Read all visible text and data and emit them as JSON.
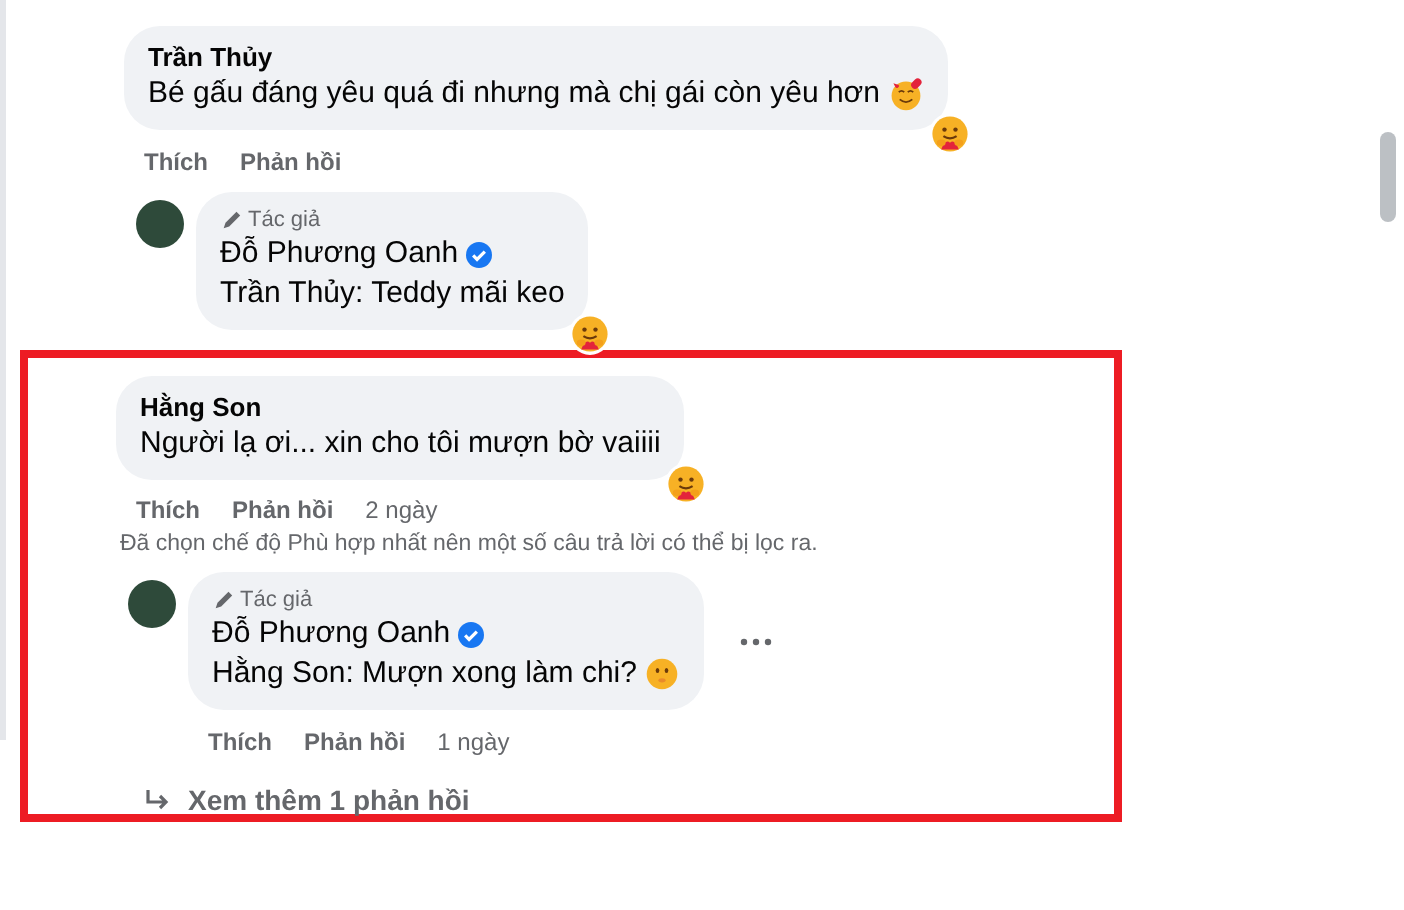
{
  "threads": [
    {
      "highlighted": false,
      "comment": {
        "author": "Trần Thủy",
        "text": "Bé gấu đáng yêu quá đi nhưng mà chị gái còn yêu hơn",
        "emoji": {
          "kind": "hearts"
        },
        "reaction": true,
        "actions": [
          "Thích",
          "Phản hồi"
        ]
      },
      "replies": [
        {
          "badge": "Tác giả",
          "author": "Đỗ Phương Oanh",
          "verified": true,
          "text": "Trần Thủy: Teddy mãi keo",
          "reaction": true,
          "more": false
        }
      ]
    },
    {
      "highlighted": true,
      "comment": {
        "author": "Hằng Son",
        "text": "Người lạ ơi... xin cho tôi mượn bờ vaiiii",
        "reaction": true,
        "actions": [
          "Thích",
          "Phản hồi"
        ],
        "time": "2 ngày"
      },
      "note": "Đã chọn chế độ Phù hợp nhất nên một số câu trả lời có thể bị lọc ra.",
      "replies": [
        {
          "badge": "Tác giả",
          "author": "Đỗ Phương Oanh",
          "verified": true,
          "text": "Hằng Son: Mượn xong làm chi?",
          "emoji": {
            "kind": "shush"
          },
          "reaction": false,
          "more": true,
          "actions": [
            "Thích",
            "Phản hồi"
          ],
          "time": "1 ngày"
        }
      ],
      "more_replies": "Xem thêm 1 phản hồi"
    }
  ]
}
